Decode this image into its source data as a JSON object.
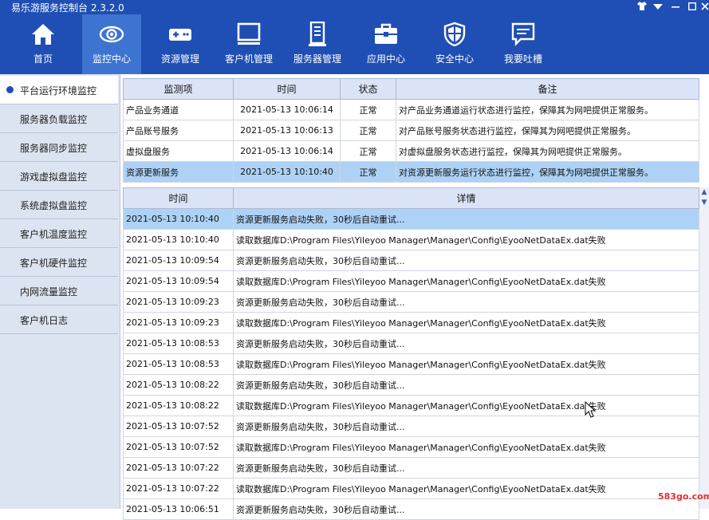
{
  "app": {
    "title": "易乐游服务控制台 2.3.2.0"
  },
  "nav": [
    {
      "label": "首页",
      "icon": "home-icon",
      "active": false
    },
    {
      "label": "监控中心",
      "icon": "eye-icon",
      "active": true
    },
    {
      "label": "资源管理",
      "icon": "gamepad-icon",
      "active": false
    },
    {
      "label": "客户机管理",
      "icon": "monitor-icon",
      "active": false
    },
    {
      "label": "服务器管理",
      "icon": "server-icon",
      "active": false
    },
    {
      "label": "应用中心",
      "icon": "toolbox-icon",
      "active": false
    },
    {
      "label": "安全中心",
      "icon": "shield-icon",
      "active": false
    },
    {
      "label": "我要吐槽",
      "icon": "feedback-icon",
      "active": false
    }
  ],
  "sidebar": {
    "items": [
      {
        "label": "平台运行环境监控",
        "active": true
      },
      {
        "label": "服务器负载监控",
        "active": false
      },
      {
        "label": "服务器同步监控",
        "active": false
      },
      {
        "label": "游戏虚拟盘监控",
        "active": false
      },
      {
        "label": "系统虚拟盘监控",
        "active": false
      },
      {
        "label": "客户机温度监控",
        "active": false
      },
      {
        "label": "客户机硬件监控",
        "active": false
      },
      {
        "label": "内网流量监控",
        "active": false
      },
      {
        "label": "客户机日志",
        "active": false
      }
    ]
  },
  "monitor_table": {
    "headers": [
      "监测项",
      "时间",
      "状态",
      "备注"
    ],
    "rows": [
      {
        "item": "产品业务通道",
        "time": "2021-05-13 10:06:14",
        "status": "正常",
        "note": "对产品业务通道运行状态进行监控，保障其为网吧提供正常服务。",
        "selected": false
      },
      {
        "item": "产品账号服务",
        "time": "2021-05-13 10:06:13",
        "status": "正常",
        "note": "对产品账号服务状态进行监控，保障其为网吧提供正常服务。",
        "selected": false
      },
      {
        "item": "虚拟盘服务",
        "time": "2021-05-13 10:06:14",
        "status": "正常",
        "note": "对虚拟盘服务状态进行监控，保障其为网吧提供正常服务。",
        "selected": false
      },
      {
        "item": "资源更新服务",
        "time": "2021-05-13 10:10:40",
        "status": "正常",
        "note": "对资源更新服务运行状态进行监控，保障其为网吧提供正常服务。",
        "selected": true
      }
    ]
  },
  "log_table": {
    "headers": [
      "时间",
      "详情"
    ],
    "rows": [
      {
        "time": "2021-05-13 10:10:40",
        "detail": "资源更新服务启动失败，30秒后自动重试...",
        "selected": true
      },
      {
        "time": "2021-05-13 10:10:40",
        "detail": "读取数据库D:\\Program Files\\Yileyoo Manager\\Manager\\Config\\EyooNetDataEx.dat失败",
        "selected": false
      },
      {
        "time": "2021-05-13 10:09:54",
        "detail": "资源更新服务启动失败，30秒后自动重试...",
        "selected": false
      },
      {
        "time": "2021-05-13 10:09:54",
        "detail": "读取数据库D:\\Program Files\\Yileyoo Manager\\Manager\\Config\\EyooNetDataEx.dat失败",
        "selected": false
      },
      {
        "time": "2021-05-13 10:09:23",
        "detail": "资源更新服务启动失败，30秒后自动重试...",
        "selected": false
      },
      {
        "time": "2021-05-13 10:09:23",
        "detail": "读取数据库D:\\Program Files\\Yileyoo Manager\\Manager\\Config\\EyooNetDataEx.dat失败",
        "selected": false
      },
      {
        "time": "2021-05-13 10:08:53",
        "detail": "资源更新服务启动失败，30秒后自动重试...",
        "selected": false
      },
      {
        "time": "2021-05-13 10:08:53",
        "detail": "读取数据库D:\\Program Files\\Yileyoo Manager\\Manager\\Config\\EyooNetDataEx.dat失败",
        "selected": false
      },
      {
        "time": "2021-05-13 10:08:22",
        "detail": "资源更新服务启动失败，30秒后自动重试...",
        "selected": false
      },
      {
        "time": "2021-05-13 10:08:22",
        "detail": "读取数据库D:\\Program Files\\Yileyoo Manager\\Manager\\Config\\EyooNetDataEx.dat失败",
        "selected": false
      },
      {
        "time": "2021-05-13 10:07:52",
        "detail": "资源更新服务启动失败，30秒后自动重试...",
        "selected": false
      },
      {
        "time": "2021-05-13 10:07:52",
        "detail": "读取数据库D:\\Program Files\\Yileyoo Manager\\Manager\\Config\\EyooNetDataEx.dat失败",
        "selected": false
      },
      {
        "time": "2021-05-13 10:07:22",
        "detail": "资源更新服务启动失败，30秒后自动重试...",
        "selected": false
      },
      {
        "time": "2021-05-13 10:07:22",
        "detail": "读取数据库D:\\Program Files\\Yileyoo Manager\\Manager\\Config\\EyooNetDataEx.dat失败",
        "selected": false
      },
      {
        "time": "2021-05-13 10:06:51",
        "detail": "资源更新服务启动失败，30秒后自动重试...",
        "selected": false
      }
    ]
  },
  "watermark": "583go.com",
  "colors": {
    "accent": "#1f4fb4",
    "nav_active": "#3d73d1",
    "selected_row": "#aed2f6"
  }
}
